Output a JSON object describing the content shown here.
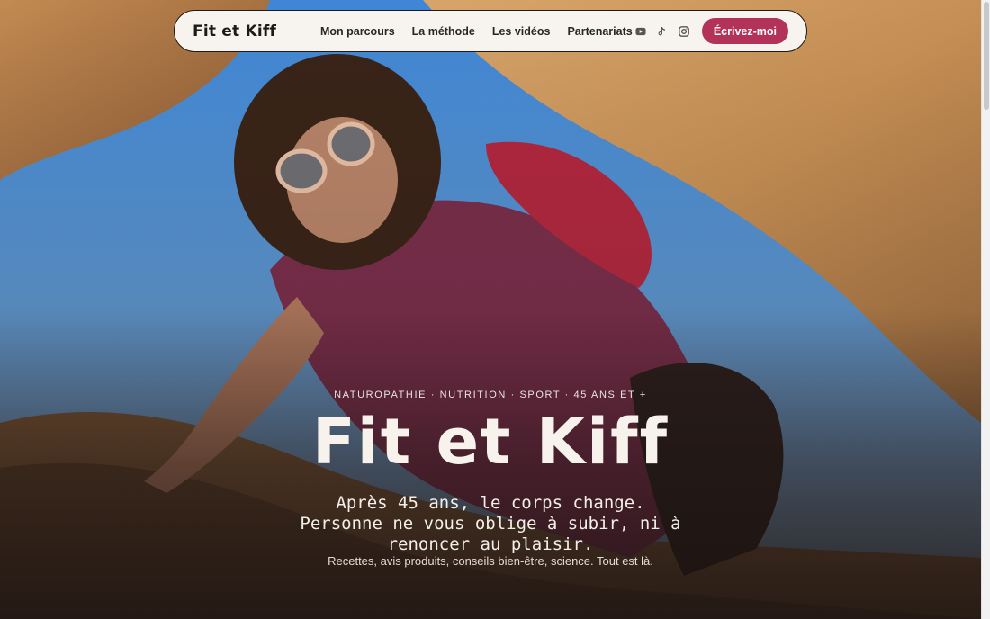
{
  "nav": {
    "brand": "Fit et Kiff",
    "links": [
      "Mon parcours",
      "La méthode",
      "Les vidéos",
      "Partenariats"
    ],
    "social_icons": [
      "youtube-icon",
      "tiktok-icon",
      "instagram-icon"
    ],
    "cta_label": "Écrivez-moi"
  },
  "hero": {
    "kicker": "NATUROPATHIE · NUTRITION · SPORT · 45 ANS ET +",
    "title": "Fit et Kiff",
    "subtitle": "Après 45 ans, le corps change. Personne ne vous oblige à subir, ni à renoncer au plaisir.",
    "lead": "Recettes, avis produits, conseils bien-être, science. Tout est là."
  },
  "colors": {
    "accent": "#b33259",
    "nav_bg": "#f7f3ee",
    "sky": "#4d8fd6",
    "rock": "#c9945c"
  }
}
